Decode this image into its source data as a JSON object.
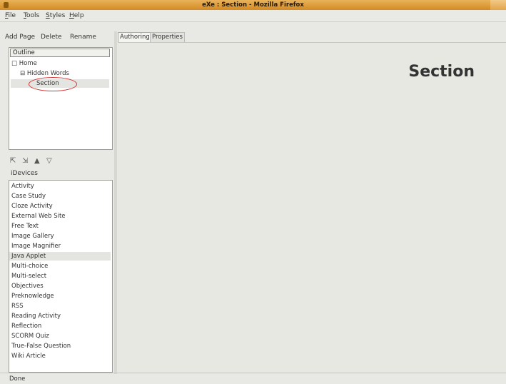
{
  "window": {
    "title": "eXe : Section - Mozilla Firefox"
  },
  "menubar": {
    "items": [
      "File",
      "Tools",
      "Styles",
      "Help"
    ]
  },
  "toolbar": {
    "add_page": "Add Page",
    "delete": "Delete",
    "rename": "Rename"
  },
  "outline": {
    "header": "Outline",
    "tree": [
      {
        "prefix": "□",
        "label": "Home"
      },
      {
        "prefix": "⊟",
        "label": "Hidden Words"
      },
      {
        "prefix": "",
        "label": "Section"
      }
    ],
    "annotation_color": "#d63232"
  },
  "reorder_icons": [
    "promote-icon",
    "demote-icon",
    "move-up-icon",
    "move-down-icon"
  ],
  "idevices": {
    "header": "iDevices",
    "items": [
      "Activity",
      "Case Study",
      "Cloze Activity",
      "External Web Site",
      "Free Text",
      "Image Gallery",
      "Image Magnifier",
      "Java Applet",
      "Multi-choice",
      "Multi-select",
      "Objectives",
      "Preknowledge",
      "RSS",
      "Reading Activity",
      "Reflection",
      "SCORM Quiz",
      "True-False Question",
      "Wiki Article"
    ],
    "selected": "Java Applet"
  },
  "tabs": [
    {
      "label": "Authoring",
      "active": true
    },
    {
      "label": "Properties",
      "active": false
    }
  ],
  "content": {
    "title": "Section"
  },
  "status": {
    "text": "Done"
  }
}
